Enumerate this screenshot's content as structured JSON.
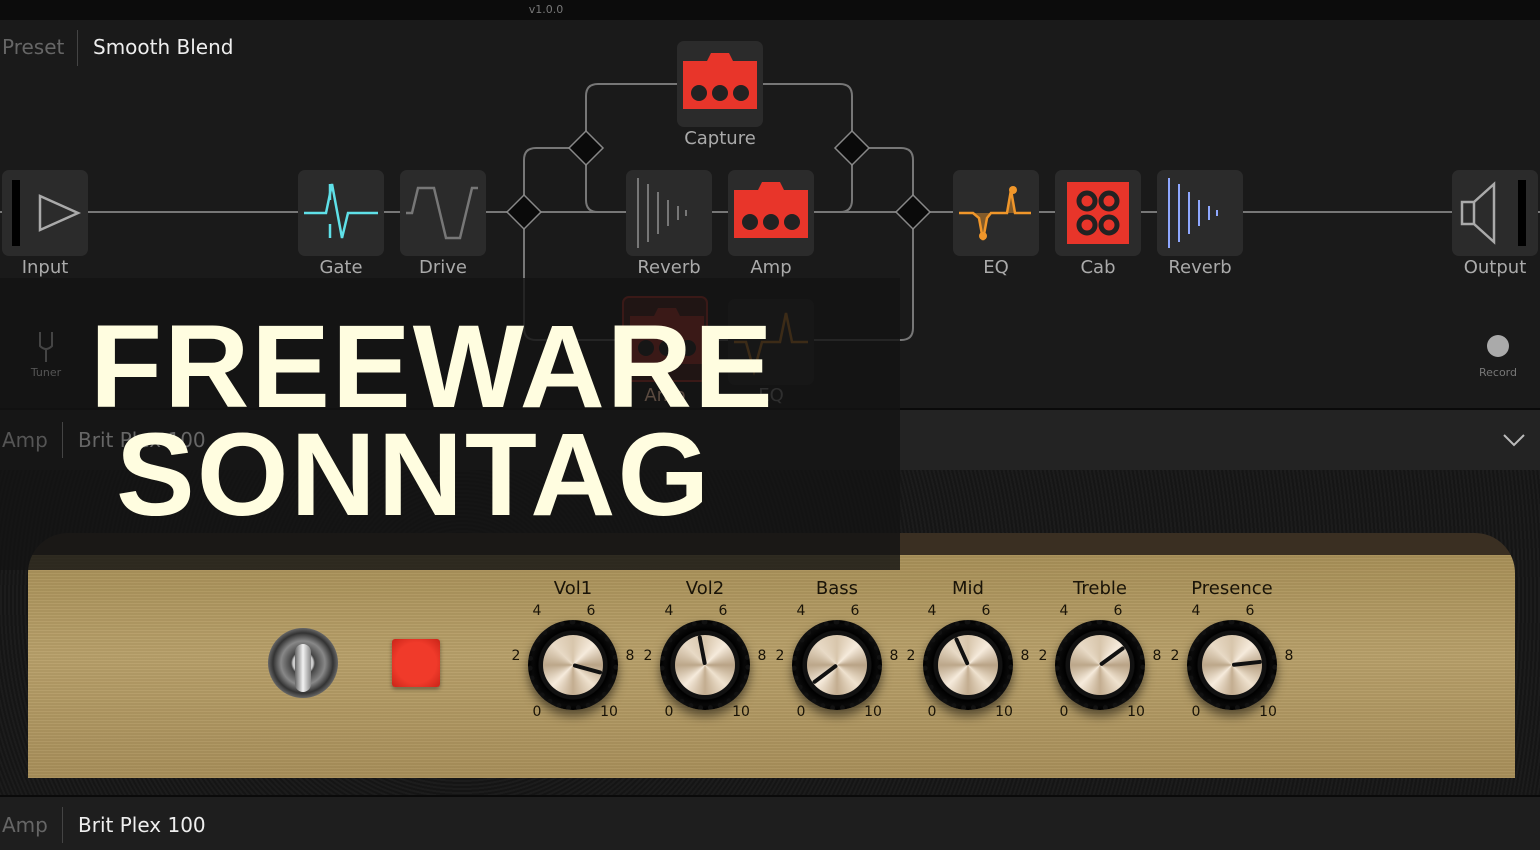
{
  "app": {
    "version": "v1.0.0"
  },
  "preset": {
    "label": "Preset",
    "value": "Smooth Blend"
  },
  "nodes": {
    "input": "Input",
    "gate": "Gate",
    "drive": "Drive",
    "capture": "Capture",
    "reverb1": "Reverb",
    "amp1": "Amp",
    "amp2": "Amp",
    "eq2": "EQ",
    "eq": "EQ",
    "cab": "Cab",
    "reverb2": "Reverb",
    "output": "Output"
  },
  "side": {
    "tuner": "Tuner",
    "record": "Record"
  },
  "amp_header": {
    "label": "Amp",
    "value": "Brit Plex 100",
    "icon": "chevron-down-icon"
  },
  "knobs": [
    {
      "label": "Vol1",
      "value": 8.9
    },
    {
      "label": "Vol2",
      "value": 4.6
    },
    {
      "label": "Bass",
      "value": 0.3
    },
    {
      "label": "Mid",
      "value": 4.1
    },
    {
      "label": "Treble",
      "value": 7.0
    },
    {
      "label": "Presence",
      "value": 8.1
    }
  ],
  "scale": [
    "0",
    "2",
    "4",
    "6",
    "8",
    "10"
  ],
  "bottom_bar": {
    "label": "Amp",
    "value": "Brit Plex 100"
  },
  "overlay": {
    "line1": "FREEWARE",
    "line2": "SONNTAG"
  },
  "colors": {
    "accent_red": "#e8352a",
    "gate_cyan": "#5fe0e8",
    "eq_orange": "#f0962a",
    "reverb_blue": "#8fa8ff",
    "overlay_text": "#fffde0"
  }
}
